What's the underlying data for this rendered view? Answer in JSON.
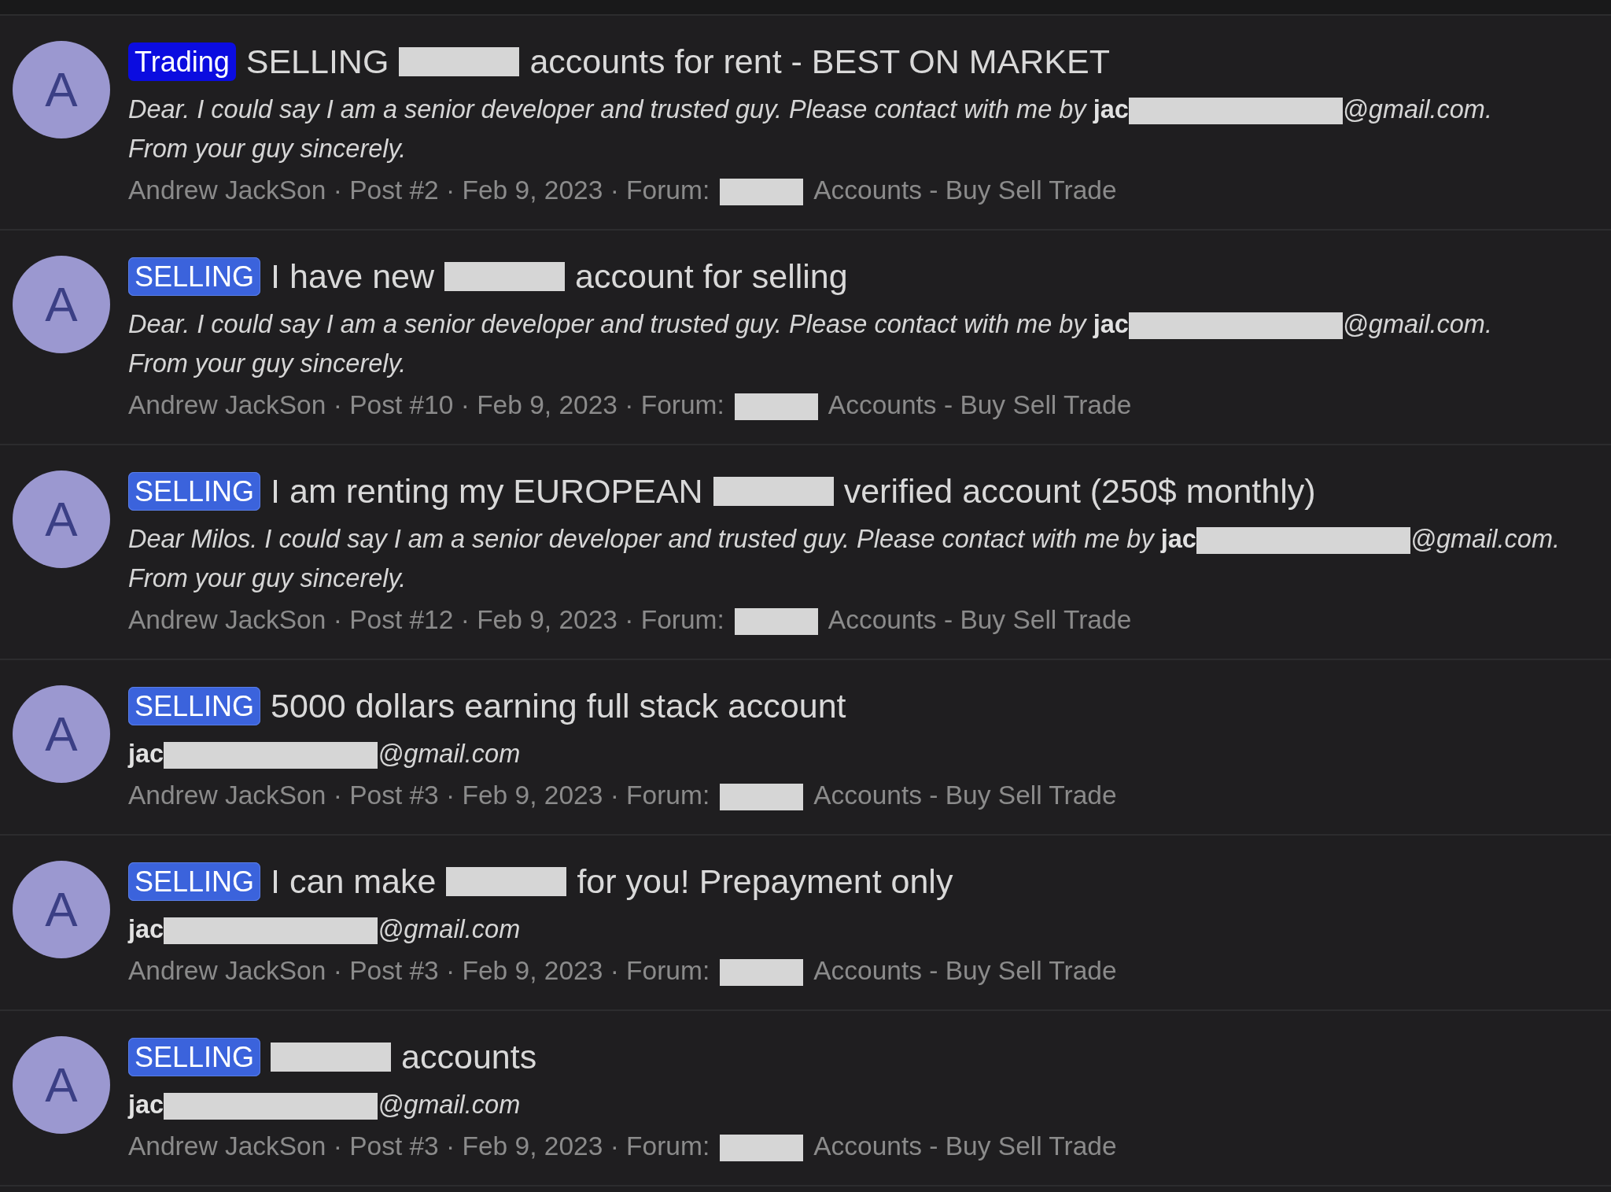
{
  "posts": [
    {
      "avatar_letter": "A",
      "prefix": {
        "label": "Trading",
        "kind": "trading"
      },
      "title": [
        {
          "kind": "text",
          "text": "SELLING"
        },
        {
          "kind": "redaction"
        },
        {
          "kind": "text",
          "text": "accounts for rent - BEST ON MARKET"
        }
      ],
      "excerpt_lines": [
        {
          "parts": [
            {
              "kind": "text",
              "text": "Dear. I could say I am a senior developer and trusted guy. Please contact with me by"
            },
            {
              "kind": "bold",
              "text": "jac"
            },
            {
              "kind": "redaction"
            },
            {
              "kind": "text",
              "text": "@gmail.com."
            }
          ]
        },
        {
          "parts": [
            {
              "kind": "text",
              "text": "From your guy sincerely."
            }
          ]
        }
      ],
      "meta": [
        {
          "kind": "text",
          "text": "Andrew JackSon · Post #2 · Feb 9, 2023 · Forum:"
        },
        {
          "kind": "redaction"
        },
        {
          "kind": "text",
          "text": "Accounts - Buy Sell Trade"
        }
      ]
    },
    {
      "avatar_letter": "A",
      "prefix": {
        "label": "SELLING",
        "kind": "selling"
      },
      "title": [
        {
          "kind": "text",
          "text": "I have new"
        },
        {
          "kind": "redaction"
        },
        {
          "kind": "text",
          "text": "account for selling"
        }
      ],
      "excerpt_lines": [
        {
          "parts": [
            {
              "kind": "text",
              "text": "Dear. I could say I am a senior developer and trusted guy. Please contact with me by"
            },
            {
              "kind": "bold",
              "text": "jac"
            },
            {
              "kind": "redaction"
            },
            {
              "kind": "text",
              "text": "@gmail.com."
            }
          ]
        },
        {
          "parts": [
            {
              "kind": "text",
              "text": "From your guy sincerely."
            }
          ]
        }
      ],
      "meta": [
        {
          "kind": "text",
          "text": "Andrew JackSon · Post #10 · Feb 9, 2023 · Forum:"
        },
        {
          "kind": "redaction"
        },
        {
          "kind": "text",
          "text": "Accounts - Buy Sell Trade"
        }
      ]
    },
    {
      "avatar_letter": "A",
      "prefix": {
        "label": "SELLING",
        "kind": "selling"
      },
      "title": [
        {
          "kind": "text",
          "text": "I am renting my EUROPEAN"
        },
        {
          "kind": "redaction"
        },
        {
          "kind": "text",
          "text": "verified account (250$ monthly)"
        }
      ],
      "excerpt_lines": [
        {
          "parts": [
            {
              "kind": "text",
              "text": "Dear Milos. I could say I am a senior developer and trusted guy. Please contact with me by"
            },
            {
              "kind": "bold",
              "text": "jac"
            },
            {
              "kind": "redaction"
            },
            {
              "kind": "text",
              "text": "@gmail.com."
            }
          ]
        },
        {
          "parts": [
            {
              "kind": "text",
              "text": "From your guy sincerely."
            }
          ]
        }
      ],
      "meta": [
        {
          "kind": "text",
          "text": "Andrew JackSon · Post #12 · Feb 9, 2023 · Forum:"
        },
        {
          "kind": "redaction"
        },
        {
          "kind": "text",
          "text": "Accounts - Buy Sell Trade"
        }
      ]
    },
    {
      "avatar_letter": "A",
      "prefix": {
        "label": "SELLING",
        "kind": "selling"
      },
      "title": [
        {
          "kind": "text",
          "text": "5000 dollars earning full stack account"
        }
      ],
      "excerpt_lines": [
        {
          "parts": [
            {
              "kind": "bold",
              "text": "jac"
            },
            {
              "kind": "redaction"
            },
            {
              "kind": "text",
              "text": "@gmail.com"
            }
          ]
        }
      ],
      "meta": [
        {
          "kind": "text",
          "text": "Andrew JackSon · Post #3 · Feb 9, 2023 · Forum:"
        },
        {
          "kind": "redaction"
        },
        {
          "kind": "text",
          "text": "Accounts - Buy Sell Trade"
        }
      ]
    },
    {
      "avatar_letter": "A",
      "prefix": {
        "label": "SELLING",
        "kind": "selling"
      },
      "title": [
        {
          "kind": "text",
          "text": "I can make"
        },
        {
          "kind": "redaction"
        },
        {
          "kind": "text",
          "text": "for you! Prepayment only"
        }
      ],
      "excerpt_lines": [
        {
          "parts": [
            {
              "kind": "bold",
              "text": "jac"
            },
            {
              "kind": "redaction"
            },
            {
              "kind": "text",
              "text": "@gmail.com"
            }
          ]
        }
      ],
      "meta": [
        {
          "kind": "text",
          "text": "Andrew JackSon · Post #3 · Feb 9, 2023 · Forum:"
        },
        {
          "kind": "redaction"
        },
        {
          "kind": "text",
          "text": "Accounts - Buy Sell Trade"
        }
      ]
    },
    {
      "avatar_letter": "A",
      "prefix": {
        "label": "SELLING",
        "kind": "selling"
      },
      "title": [
        {
          "kind": "redaction"
        },
        {
          "kind": "text",
          "text": "accounts"
        }
      ],
      "excerpt_lines": [
        {
          "parts": [
            {
              "kind": "bold",
              "text": "jac"
            },
            {
              "kind": "redaction"
            },
            {
              "kind": "text",
              "text": "@gmail.com"
            }
          ]
        }
      ],
      "meta": [
        {
          "kind": "text",
          "text": "Andrew JackSon · Post #3 · Feb 9, 2023 · Forum:"
        },
        {
          "kind": "redaction"
        },
        {
          "kind": "text",
          "text": "Accounts - Buy Sell Trade"
        }
      ]
    }
  ]
}
